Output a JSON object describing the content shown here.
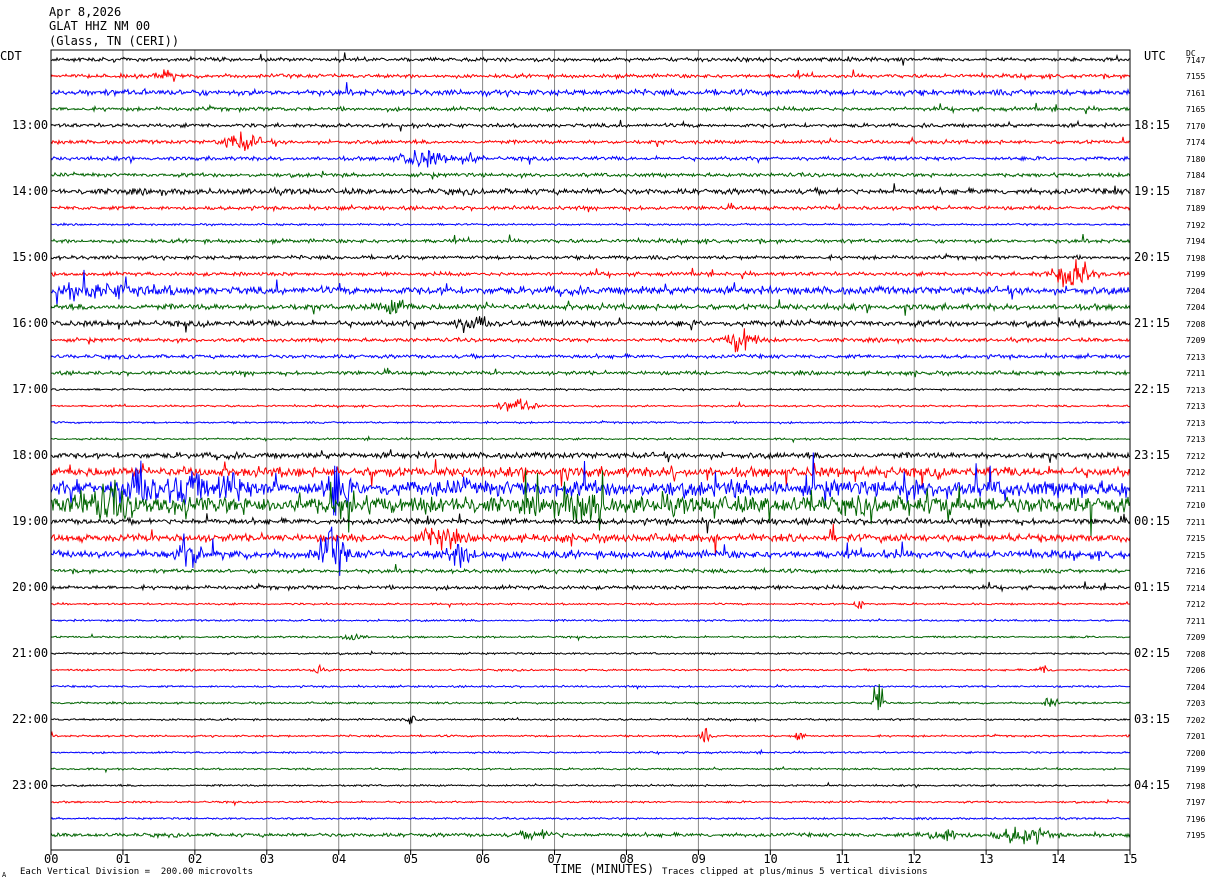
{
  "header": {
    "date": "Apr 8,2026",
    "station": "GLAT HHZ NM 00",
    "location": "(Glass, TN (CERI))"
  },
  "labels": {
    "left_zone": "CDT",
    "right_zone": "UTC",
    "dc_header": "DC",
    "xlabel": "TIME (MINUTES)",
    "scale_note": "Each Vertical Division =  200.00 microvolts",
    "clip_note": "Traces clipped at plus/minus 5 vertical divisions",
    "corner_mark": "A"
  },
  "colors": {
    "black": "#000000",
    "red": "#ff0000",
    "blue": "#0000ff",
    "green": "#006400",
    "grid": "#888888"
  },
  "chart_data": {
    "type": "helicorder",
    "trace_minutes": 15,
    "traces_per_hour": 4,
    "trace_color_cycle": [
      "black",
      "red",
      "blue",
      "green"
    ],
    "x_ticks": [
      "00",
      "01",
      "02",
      "03",
      "04",
      "05",
      "06",
      "07",
      "08",
      "09",
      "10",
      "11",
      "12",
      "13",
      "14",
      "15"
    ],
    "xlim": [
      0,
      15
    ],
    "left_hour_labels": [
      "13:00",
      "14:00",
      "15:00",
      "16:00",
      "17:00",
      "18:00",
      "19:00",
      "20:00",
      "21:00",
      "22:00",
      "23:00"
    ],
    "right_hour_labels": [
      "18:15",
      "19:15",
      "20:15",
      "21:15",
      "22:15",
      "23:15",
      "00:15",
      "01:15",
      "02:15",
      "03:15",
      "04:15"
    ],
    "hour_label_first_trace": 4,
    "dc_offsets": [
      "7147",
      "7155",
      "7161",
      "7165",
      "7170",
      "7174",
      "7180",
      "7184",
      "7187",
      "7189",
      "7192",
      "7194",
      "7198",
      "7199",
      "7204",
      "7204",
      "7208",
      "7209",
      "7213",
      "7211",
      "7213",
      "7213",
      "7213",
      "7213",
      "7212",
      "7212",
      "7211",
      "7210",
      "7211",
      "7215",
      "7215",
      "7216",
      "7214",
      "7212",
      "7211",
      "7209",
      "7208",
      "7206",
      "7204",
      "7203",
      "7202",
      "7201",
      "7200",
      "7199",
      "7198",
      "7197",
      "7196",
      "7195"
    ],
    "noise_level": [
      2,
      2,
      3,
      2,
      2,
      2,
      2,
      2,
      3,
      2,
      1,
      2,
      2,
      2,
      4,
      3,
      3,
      2,
      2,
      2,
      1,
      1,
      1,
      1,
      3,
      5,
      8,
      9,
      3,
      4,
      4,
      2,
      2,
      1,
      1,
      1,
      1,
      1,
      1,
      1,
      1,
      1,
      1,
      1,
      1,
      1,
      1,
      2
    ],
    "events": [
      {
        "trace": 1,
        "minute": 1.6,
        "amp": 4,
        "dur": 0.3
      },
      {
        "trace": 5,
        "minute": 2.65,
        "amp": 9,
        "dur": 0.45
      },
      {
        "trace": 6,
        "minute": 5.15,
        "amp": 8,
        "dur": 0.6
      },
      {
        "trace": 6,
        "minute": 5.8,
        "amp": 4,
        "dur": 0.3
      },
      {
        "trace": 13,
        "minute": 14.2,
        "amp": 14,
        "dur": 0.55
      },
      {
        "trace": 14,
        "minute": 0.6,
        "amp": 5,
        "dur": 1.8
      },
      {
        "trace": 15,
        "minute": 4.8,
        "amp": 7,
        "dur": 0.4
      },
      {
        "trace": 16,
        "minute": 5.85,
        "amp": 8,
        "dur": 0.4
      },
      {
        "trace": 17,
        "minute": 9.6,
        "amp": 14,
        "dur": 0.35
      },
      {
        "trace": 21,
        "minute": 6.5,
        "amp": 6,
        "dur": 0.5
      },
      {
        "trace": 26,
        "minute": 1.2,
        "amp": 18,
        "dur": 0.5
      },
      {
        "trace": 26,
        "minute": 1.9,
        "amp": 16,
        "dur": 0.35
      },
      {
        "trace": 26,
        "minute": 2.5,
        "amp": 13,
        "dur": 0.3
      },
      {
        "trace": 26,
        "minute": 3.95,
        "amp": 22,
        "dur": 0.25
      },
      {
        "trace": 27,
        "minute": 0.8,
        "amp": 12,
        "dur": 0.6
      },
      {
        "trace": 27,
        "minute": 7.4,
        "amp": 12,
        "dur": 0.4
      },
      {
        "trace": 29,
        "minute": 5.4,
        "amp": 11,
        "dur": 0.4
      },
      {
        "trace": 30,
        "minute": 1.9,
        "amp": 20,
        "dur": 0.3
      },
      {
        "trace": 30,
        "minute": 3.9,
        "amp": 22,
        "dur": 0.35
      },
      {
        "trace": 30,
        "minute": 5.7,
        "amp": 10,
        "dur": 0.4
      },
      {
        "trace": 33,
        "minute": 11.25,
        "amp": 10,
        "dur": 0.1
      },
      {
        "trace": 35,
        "minute": 4.2,
        "amp": 5,
        "dur": 0.25
      },
      {
        "trace": 37,
        "minute": 3.7,
        "amp": 6,
        "dur": 0.12
      },
      {
        "trace": 37,
        "minute": 13.8,
        "amp": 6,
        "dur": 0.15
      },
      {
        "trace": 39,
        "minute": 11.5,
        "amp": 22,
        "dur": 0.15
      },
      {
        "trace": 39,
        "minute": 13.9,
        "amp": 8,
        "dur": 0.15
      },
      {
        "trace": 40,
        "minute": 5.0,
        "amp": 5,
        "dur": 0.2
      },
      {
        "trace": 41,
        "minute": 9.1,
        "amp": 7,
        "dur": 0.12
      },
      {
        "trace": 41,
        "minute": 10.4,
        "amp": 7,
        "dur": 0.12
      },
      {
        "trace": 47,
        "minute": 6.8,
        "amp": 4,
        "dur": 0.5
      },
      {
        "trace": 47,
        "minute": 12.4,
        "amp": 6,
        "dur": 0.5
      },
      {
        "trace": 47,
        "minute": 13.5,
        "amp": 9,
        "dur": 0.6
      }
    ]
  }
}
